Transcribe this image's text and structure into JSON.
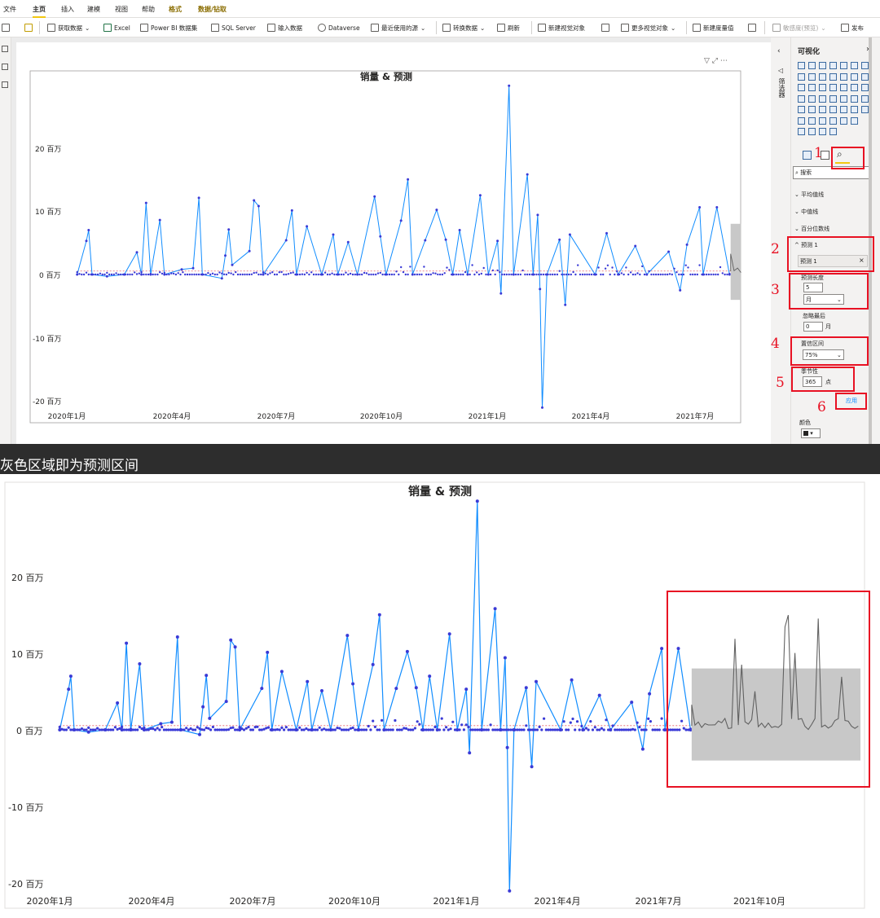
{
  "menubar": {
    "items": [
      "文件",
      "主页",
      "插入",
      "建模",
      "视图",
      "帮助",
      "格式",
      "数据/钻取"
    ],
    "active": "主页"
  },
  "ribbon": {
    "get_data": "获取数据",
    "excel": "Excel",
    "pbi_dataset": "Power BI 数据集",
    "sql_server": "SQL Server",
    "enter_data": "输入数据",
    "dataverse": "Dataverse",
    "recent_sources": "最近使用的源",
    "transform_data": "转换数据",
    "refresh": "刷新",
    "new_visual": "新建视觉对象",
    "more_visuals": "更多视觉对象",
    "new_measure": "新建度量值",
    "sensitivity": "敏感度(预览)",
    "publish": "发布"
  },
  "visual": {
    "title": "销量 & 预测",
    "y_ticks": [
      "20 百万",
      "10 百万",
      "0 百万",
      "-10 百万",
      "-20 百万"
    ],
    "x_ticks": [
      "2020年1月",
      "2020年4月",
      "2020年7月",
      "2020年10月",
      "2021年1月",
      "2021年4月",
      "2021年7月"
    ]
  },
  "pane": {
    "filter_tab": "筛选器",
    "title": "可视化",
    "search_placeholder": "搜索",
    "sections": [
      "平均值线",
      "中值线",
      "百分位数线"
    ],
    "forecast_header": "预测",
    "forecast_count": "1",
    "forecast_item": "预测 1",
    "forecast_length_label": "预测长度",
    "forecast_length_value": "5",
    "forecast_length_unit": "月",
    "ignore_last_label": "忽略最后",
    "ignore_last_value": "0",
    "ignore_last_unit": "月",
    "confidence_label": "置信区间",
    "confidence_value": "75%",
    "seasonality_label": "季节性",
    "seasonality_value": "365",
    "seasonality_unit": "点",
    "apply": "应用",
    "color_label": "颜色",
    "steps": [
      "1",
      "2",
      "3",
      "4",
      "5",
      "6"
    ]
  },
  "caption": "灰色区域即为预测区间",
  "bottom_chart": {
    "title": "销量 & 预测",
    "y_ticks": [
      "20 百万",
      "10 百万",
      "0 百万",
      "-10 百万",
      "-20 百万"
    ],
    "x_ticks": [
      "2020年1月",
      "2020年4月",
      "2020年7月",
      "2020年10月",
      "2021年1月",
      "2021年4月",
      "2021年7月",
      "2021年10月"
    ]
  },
  "colors": {
    "line": "#118dff",
    "marker": "#3a3ad6",
    "forecast_band": "#c8c8c8",
    "forecast_line": "#606060",
    "highlight": "#e81123",
    "ref_line": "#e8626a"
  },
  "chart_data": [
    {
      "type": "line",
      "title": "销量 & 预测",
      "y_unit": "百万",
      "ylim": [
        -22,
        32
      ],
      "x_range": [
        "2020-01-01",
        "2021-08-31"
      ],
      "series": [
        {
          "kind": "actual",
          "points": [
            [
              "2020-01-10",
              0
            ],
            [
              "2020-01-18",
              5.3
            ],
            [
              "2020-01-20",
              7.0
            ],
            [
              "2020-01-23",
              0
            ],
            [
              "2020-02-05",
              -0.3
            ],
            [
              "2020-02-20",
              0
            ],
            [
              "2020-03-02",
              3.5
            ],
            [
              "2020-03-06",
              0
            ],
            [
              "2020-03-10",
              11.3
            ],
            [
              "2020-03-14",
              0
            ],
            [
              "2020-03-22",
              8.6
            ],
            [
              "2020-03-26",
              0
            ],
            [
              "2020-04-10",
              0.8
            ],
            [
              "2020-04-20",
              1.0
            ],
            [
              "2020-04-25",
              12.1
            ],
            [
              "2020-04-28",
              0
            ],
            [
              "2020-05-15",
              -0.6
            ],
            [
              "2020-05-18",
              3.0
            ],
            [
              "2020-05-21",
              7.1
            ],
            [
              "2020-05-24",
              1.5
            ],
            [
              "2020-06-08",
              3.7
            ],
            [
              "2020-06-12",
              11.7
            ],
            [
              "2020-06-16",
              10.8
            ],
            [
              "2020-06-20",
              0
            ],
            [
              "2020-07-10",
              5.4
            ],
            [
              "2020-07-15",
              10.1
            ],
            [
              "2020-07-19",
              0
            ],
            [
              "2020-07-28",
              7.6
            ],
            [
              "2020-08-10",
              0
            ],
            [
              "2020-08-20",
              6.3
            ],
            [
              "2020-08-24",
              0
            ],
            [
              "2020-09-02",
              5.1
            ],
            [
              "2020-09-10",
              0
            ],
            [
              "2020-09-25",
              12.3
            ],
            [
              "2020-09-30",
              6.0
            ],
            [
              "2020-10-05",
              0
            ],
            [
              "2020-10-18",
              8.5
            ],
            [
              "2020-10-24",
              15.0
            ],
            [
              "2020-10-28",
              0
            ],
            [
              "2020-11-08",
              5.4
            ],
            [
              "2020-11-18",
              10.2
            ],
            [
              "2020-11-26",
              5.5
            ],
            [
              "2020-12-02",
              0
            ],
            [
              "2020-12-08",
              7.0
            ],
            [
              "2020-12-15",
              0
            ],
            [
              "2020-12-26",
              12.5
            ],
            [
              "2021-01-02",
              0
            ],
            [
              "2021-01-10",
              5.3
            ],
            [
              "2021-01-13",
              -3.0
            ],
            [
              "2021-01-20",
              29.8
            ],
            [
              "2021-01-24",
              0
            ],
            [
              "2021-02-05",
              15.8
            ],
            [
              "2021-02-10",
              0
            ],
            [
              "2021-02-14",
              9.4
            ],
            [
              "2021-02-16",
              -2.3
            ],
            [
              "2021-02-18",
              -21.0
            ],
            [
              "2021-02-22",
              0
            ],
            [
              "2021-03-05",
              5.5
            ],
            [
              "2021-03-10",
              -4.8
            ],
            [
              "2021-03-14",
              6.3
            ],
            [
              "2021-04-05",
              0
            ],
            [
              "2021-04-15",
              6.5
            ],
            [
              "2021-04-25",
              0
            ],
            [
              "2021-05-10",
              4.5
            ],
            [
              "2021-05-20",
              0
            ],
            [
              "2021-06-08",
              3.6
            ],
            [
              "2021-06-18",
              -2.5
            ],
            [
              "2021-06-24",
              4.7
            ],
            [
              "2021-07-05",
              10.6
            ],
            [
              "2021-07-08",
              0
            ],
            [
              "2021-07-20",
              10.6
            ],
            [
              "2021-07-31",
              0
            ]
          ]
        }
      ],
      "forecast": {
        "confidence": "75%",
        "range": [
          "2021-08-01",
          "2021-12-31"
        ],
        "band": [
          -4,
          8
        ]
      }
    }
  ]
}
